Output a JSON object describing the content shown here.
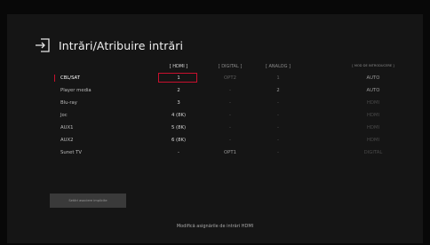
{
  "title": "Intrări/Atribuire intrări",
  "columns": {
    "hdmi": "[ HDMI ]",
    "digital": "[ DIGITAL ]",
    "analog": "[ ANALOG ]",
    "mode": "[ MOD DE INTRODUCERE ]"
  },
  "rows": [
    {
      "label": "CBL/SAT",
      "hdmi": "1",
      "digital": "OPT2",
      "analog": "1",
      "mode": "AUTO"
    },
    {
      "label": "Player media",
      "hdmi": "2",
      "digital": "-",
      "analog": "2",
      "mode": "AUTO"
    },
    {
      "label": "Blu-ray",
      "hdmi": "3",
      "digital": "-",
      "analog": "-",
      "mode": "HDMI"
    },
    {
      "label": "Joc",
      "hdmi": "4 (8K)",
      "digital": "-",
      "analog": "-",
      "mode": "HDMI"
    },
    {
      "label": "AUX1",
      "hdmi": "5 (8K)",
      "digital": "-",
      "analog": "-",
      "mode": "HDMI"
    },
    {
      "label": "AUX2",
      "hdmi": "6 (8K)",
      "digital": "-",
      "analog": "-",
      "mode": "HDMI"
    },
    {
      "label": "Sunet TV",
      "hdmi": "-",
      "digital": "OPT1",
      "analog": "-",
      "mode": "DIGITAL"
    }
  ],
  "reset_label": "Setări asociere implicite",
  "hint": "Modifică asignările de intrări HDMI",
  "icons": {
    "title": "input-arrow-icon"
  },
  "colors": {
    "accent": "#c8102e",
    "background": "#151515"
  }
}
